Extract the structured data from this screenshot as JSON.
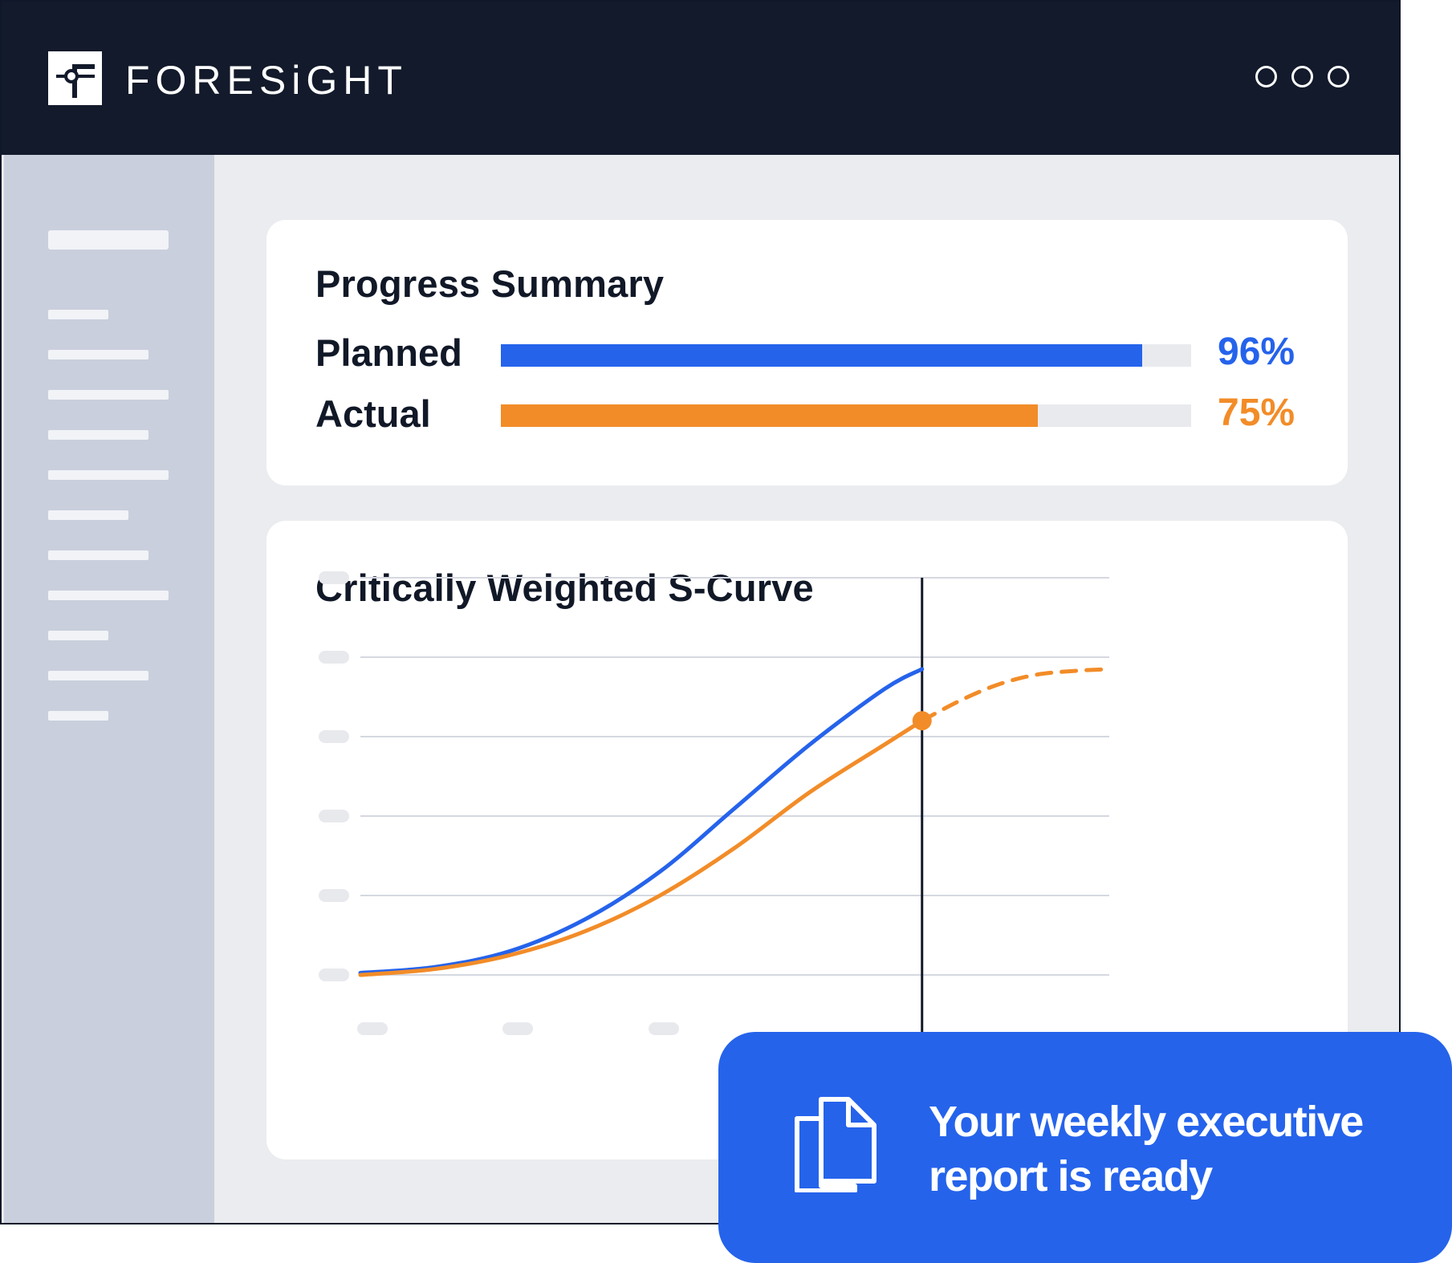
{
  "app": {
    "brand": "FORESiGHT",
    "window_controls": [
      "dot-1",
      "dot-2",
      "dot-3"
    ]
  },
  "progress_summary": {
    "title": "Progress Summary",
    "rows": [
      {
        "label": "Planned",
        "value_text": "96%",
        "fraction": 0.929,
        "color": "#2563eb"
      },
      {
        "label": "Actual",
        "value_text": "75%",
        "fraction": 0.778,
        "color": "#f28c28"
      }
    ]
  },
  "chart": {
    "title": "Critically Weighted S-Curve"
  },
  "chart_data": {
    "type": "line",
    "title": "Critically Weighted S-Curve",
    "xlabel": "",
    "ylabel": "",
    "xlim": [
      0,
      100
    ],
    "ylim": [
      0,
      100
    ],
    "grid": true,
    "status_line_x": 75,
    "series": [
      {
        "color": "#2563eb",
        "style": "solid",
        "x": [
          0,
          10,
          20,
          30,
          40,
          50,
          60,
          70,
          75
        ],
        "y": [
          0.5,
          2,
          6,
          14,
          26,
          42,
          58,
          72,
          77
        ]
      },
      {
        "color": "#f28c28",
        "style": "solid",
        "x": [
          0,
          10,
          20,
          30,
          40,
          50,
          60,
          70,
          75
        ],
        "y": [
          0,
          1.5,
          5,
          11,
          20,
          32,
          46,
          58,
          64
        ]
      },
      {
        "color": "#f28c28",
        "style": "dashed",
        "x": [
          75,
          80,
          85,
          90,
          95,
          100
        ],
        "y": [
          64,
          69,
          73,
          75.5,
          76.5,
          77
        ]
      }
    ]
  },
  "notification": {
    "text": "Your weekly executive\nreport is ready"
  }
}
